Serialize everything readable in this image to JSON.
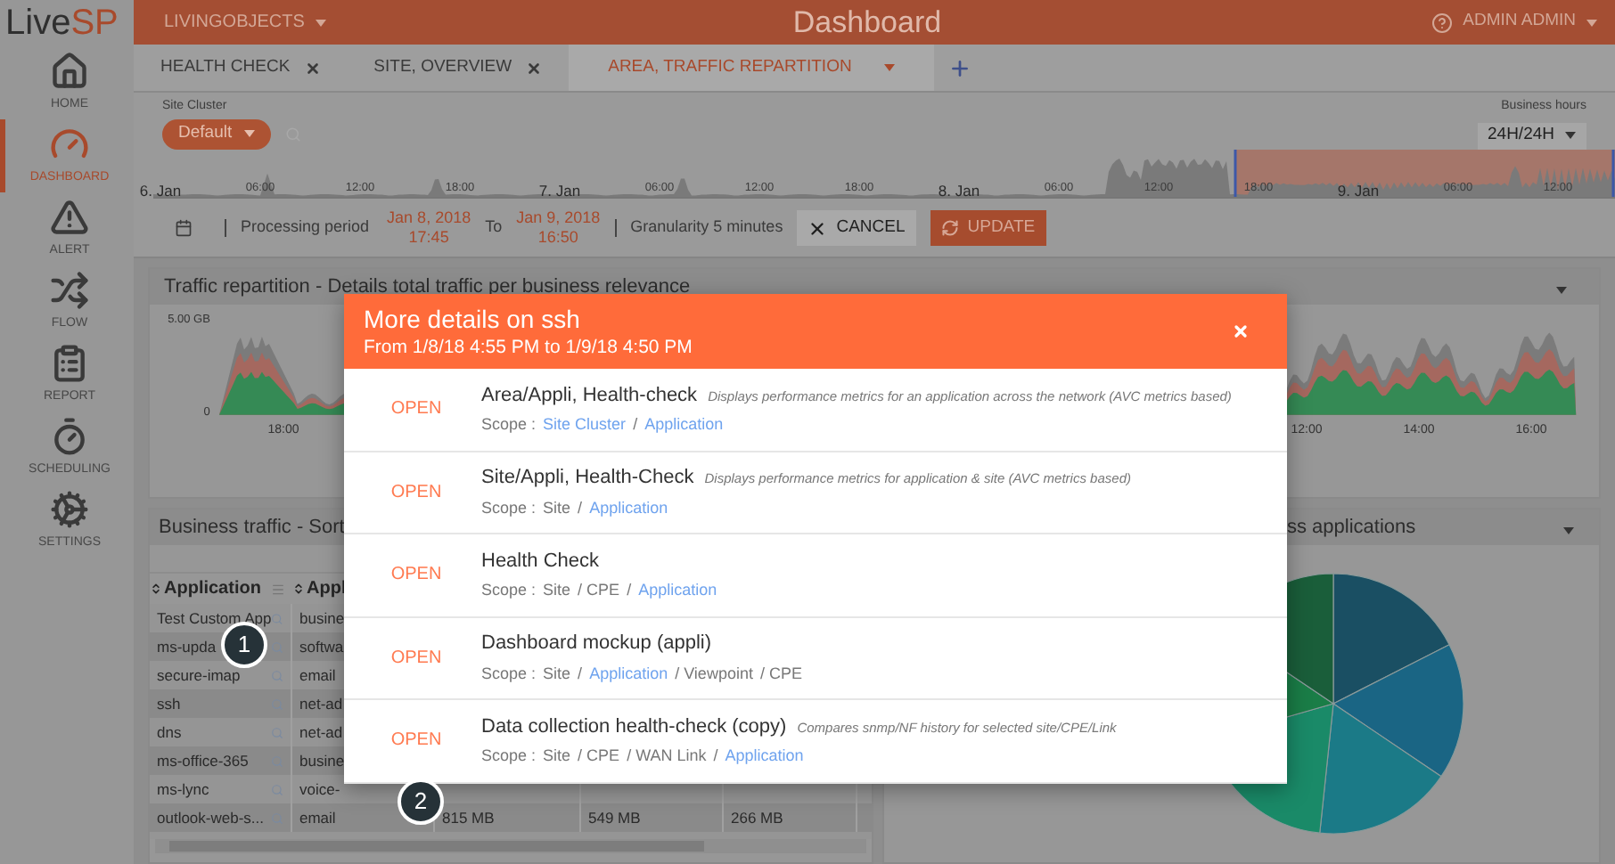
{
  "logo": {
    "part_1": "Live",
    "part_2": "SP"
  },
  "header": {
    "org": "LIVINGOBJECTS",
    "title": "Dashboard",
    "user": "ADMIN ADMIN"
  },
  "sidebar": {
    "items": [
      {
        "label": "HOME",
        "selected": false
      },
      {
        "label": "DASHBOARD",
        "selected": true
      },
      {
        "label": "ALERT",
        "selected": false
      },
      {
        "label": "FLOW",
        "selected": false
      },
      {
        "label": "REPORT",
        "selected": false
      },
      {
        "label": "SCHEDULING",
        "selected": false
      },
      {
        "label": "SETTINGS",
        "selected": false
      }
    ]
  },
  "tabs": [
    {
      "label": "HEALTH CHECK",
      "selected": false,
      "closable": true
    },
    {
      "label": "SITE, OVERVIEW",
      "selected": false,
      "closable": true
    },
    {
      "label": "AREA, TRAFFIC REPARTITION",
      "selected": true,
      "closable": false
    }
  ],
  "filters": {
    "site_cluster_label": "Site Cluster",
    "site_cluster": "Default",
    "business_hours_label": "Business hours",
    "business_hours": "24H/24H"
  },
  "timeline": {
    "labels": [
      "6. Jan",
      "06:00",
      "12:00",
      "18:00",
      "7. Jan",
      "06:00",
      "12:00",
      "18:00",
      "8. Jan",
      "06:00",
      "12:00",
      "18:00",
      "9. Jan",
      "06:00",
      "12:00"
    ]
  },
  "period": {
    "label": "Processing period",
    "from_date": "Jan 8, 2018",
    "from_time": "17:45",
    "to_label": "To",
    "to_date": "Jan 9, 2018",
    "to_time": "16:50",
    "granularity": "Granularity 5 minutes",
    "cancel": "CANCEL",
    "update": "UPDATE"
  },
  "traffic_panel": {
    "title": "Traffic repartition - Details total traffic per business relevance",
    "y_labels": [
      "5.00 GB",
      "0"
    ],
    "x_labels": [
      "18:00",
      "12:00",
      "14:00",
      "16:00"
    ]
  },
  "business_panel": {
    "title": "Business traffic - Sort",
    "columns": [
      "Application",
      "Appl"
    ],
    "rows": [
      {
        "cells": [
          "Test Custom App",
          "busine"
        ]
      },
      {
        "cells": [
          "ms-upda",
          "softwa"
        ]
      },
      {
        "cells": [
          "secure-imap",
          "email"
        ]
      },
      {
        "cells": [
          "ssh",
          "net-ad"
        ]
      },
      {
        "cells": [
          "dns",
          "net-ad"
        ]
      },
      {
        "cells": [
          "ms-office-365",
          "busine"
        ]
      },
      {
        "cells": [
          "ms-lync",
          "voice-"
        ]
      },
      {
        "cells": [
          "outlook-web-s...",
          "email",
          "815 MB",
          "549 MB",
          "266 MB"
        ]
      }
    ]
  },
  "apps_panel": {
    "title": "ss applications"
  },
  "modal": {
    "title": "More details on ssh",
    "subtitle": "From 1/8/18 4:55 PM to 1/9/18 4:50 PM",
    "items": [
      {
        "action": "OPEN",
        "scope_label": "Scope  :",
        "title": "Area/Appli, Health-check",
        "description": "Displays performance metrics for an application across the network (AVC metrics based)",
        "scope": [
          {
            "text": "Site Cluster",
            "link": true
          },
          {
            "text": "/",
            "link": false
          },
          {
            "text": "Application",
            "link": true
          }
        ]
      },
      {
        "action": "OPEN",
        "scope_label": "Scope  :",
        "title": "Site/Appli, Health-Check",
        "description": "Displays performance metrics for application & site (AVC metrics based)",
        "scope": [
          {
            "text": "Site",
            "link": false
          },
          {
            "text": "/",
            "link": false
          },
          {
            "text": "Application",
            "link": true
          }
        ]
      },
      {
        "action": "OPEN",
        "scope_label": "Scope  :",
        "title": "Health Check",
        "scope": [
          {
            "text": "Site",
            "link": false
          },
          {
            "text": "/ CPE",
            "link": false
          },
          {
            "text": "/",
            "link": false
          },
          {
            "text": "Application",
            "link": true
          }
        ]
      },
      {
        "action": "OPEN",
        "scope_label": "Scope  :",
        "title": "Dashboard mockup (appli)",
        "scope": [
          {
            "text": "Site",
            "link": false
          },
          {
            "text": "/",
            "link": false
          },
          {
            "text": "Application",
            "link": true
          },
          {
            "text": "/ Viewpoint",
            "link": false
          },
          {
            "text": "/ CPE",
            "link": false
          }
        ]
      },
      {
        "action": "OPEN",
        "scope_label": "Scope  :",
        "title": "Data collection health-check (copy)",
        "description": "Compares snmp/NF history for selected site/CPE/Link",
        "scope": [
          {
            "text": "Site",
            "link": false
          },
          {
            "text": "/ CPE",
            "link": false
          },
          {
            "text": "/ WAN Link",
            "link": false
          },
          {
            "text": "/",
            "link": false
          },
          {
            "text": "Application",
            "link": true
          }
        ]
      }
    ]
  },
  "callouts": [
    "1",
    "2"
  ]
}
